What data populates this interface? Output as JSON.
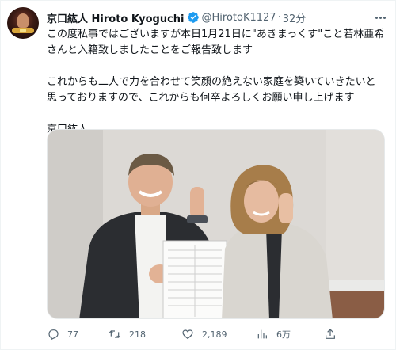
{
  "author": {
    "name": "京口紘人 Hiroto Kyoguchi",
    "handle": "@HirotoK1127",
    "dot": "·",
    "time": "32分"
  },
  "tweet": {
    "paragraph1": "この度私事ではございますが本日1月21日に\"あきまっくす\"こと若林亜希さんと入籍致しましたことをご報告致します",
    "paragraph2": "これからも二人で力を合わせて笑顔の絶えない家庭を築いていきたいと思っておりますので、これからも何卒よろしくお願い申し上げます",
    "signature": "京口紘人"
  },
  "actions": {
    "reply_count": "77",
    "retweet_count": "218",
    "like_count": "2,189",
    "views_count": "6万"
  },
  "icons": {
    "verified": "verified-badge-icon",
    "more": "more-icon",
    "reply": "reply-icon",
    "retweet": "retweet-icon",
    "like": "heart-icon",
    "views": "views-chart-icon",
    "share": "share-icon"
  },
  "colors": {
    "text": "#0f1419",
    "secondary": "#536471",
    "verified": "#1d9bf0"
  }
}
